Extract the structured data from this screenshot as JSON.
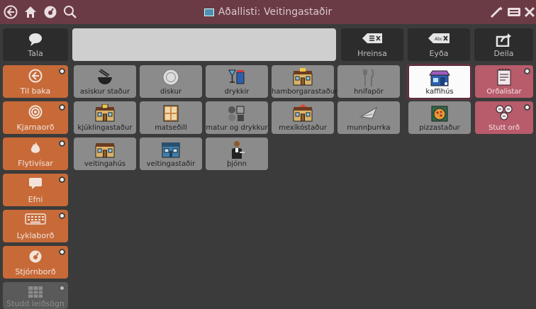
{
  "title": {
    "text": "Aðallisti: Veitingastaðir"
  },
  "toolbar": {
    "tala": "Tala",
    "hreinsa": "Hreinsa",
    "eyda": "Eyða",
    "deila": "Deila"
  },
  "sidebar": [
    {
      "label": "Til baka"
    },
    {
      "label": "Kjarnaorð"
    },
    {
      "label": "Flytivísar"
    },
    {
      "label": "Efni"
    },
    {
      "label": "Lyklaborð"
    },
    {
      "label": "Stjórnborð"
    },
    {
      "label": "Studd leiðsögn"
    }
  ],
  "grid": [
    {
      "label": "asiskur staður"
    },
    {
      "label": "diskur"
    },
    {
      "label": "drykkir"
    },
    {
      "label": "hamborgarastaður"
    },
    {
      "label": "hnífapör"
    },
    {
      "label": "kaffihús"
    },
    {
      "label": "Orðalistar"
    },
    {
      "label": "kjúklingastaður"
    },
    {
      "label": "matseðill"
    },
    {
      "label": "matur og drykkur"
    },
    {
      "label": "mexíkóstaður"
    },
    {
      "label": "munnþurrka"
    },
    {
      "label": "pizzastaður"
    },
    {
      "label": "Stutt orð"
    },
    {
      "label": "veitingahús"
    },
    {
      "label": "veitingastaðir"
    },
    {
      "label": "þjónn"
    }
  ],
  "colors": {
    "titlebar": "#6a3a45",
    "sidebar": "#c76a38",
    "cell": "#8b8b8b",
    "selected_border": "#5b2b3a",
    "accent_pink": "#b85b6b"
  }
}
